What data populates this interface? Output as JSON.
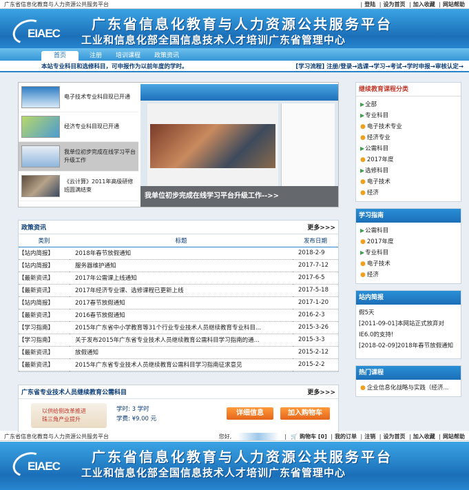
{
  "site_name": "广东省信息化教育与人力资源公共服务平台",
  "top_links": [
    "登陆",
    "设为首页",
    "加入收藏",
    "网站帮助"
  ],
  "banner": {
    "logo_text": "EIAEC",
    "title_line1": "广东省信息化教育与人力资源公共服务平台",
    "title_line2": "工业和信息化部全国信息技术人才培训广东省管理中心"
  },
  "nav": {
    "tabs": [
      "首页",
      "注册",
      "培训课程",
      "政策资讯"
    ]
  },
  "notice": {
    "text": "本站专业科目和选修科目，可申报作为以前年度的学时。",
    "flow": "[学习流程] 注册/登录→选课→学习→考试→学时申报→审核认定→"
  },
  "slider": {
    "thumbs": [
      "电子技术专业科目现已开通",
      "经济专业科目现已开通",
      "我单位初步完成在线学习平台升级工作",
      "《云计算》2011年高级研修班圆满结束"
    ],
    "caption": "我单位初步完成在线学习平台升级工作-->>"
  },
  "policy": {
    "title": "政策资讯",
    "more": "更多>>>",
    "headers": [
      "类别",
      "标题",
      "发布日期"
    ],
    "rows": [
      [
        "【站内简报】",
        "2018年春节放假通知",
        "2018-2-9"
      ],
      [
        "【站内简报】",
        "服务器维护通知",
        "2017-7-12"
      ],
      [
        "【最新资讯】",
        "2017年公需课上线通知",
        "2017-6-5"
      ],
      [
        "【最新资讯】",
        "2017年经济专业课、选修课程已更新上线",
        "2017-5-18"
      ],
      [
        "【站内简报】",
        "2017春节放假通知",
        "2017-1-20"
      ],
      [
        "【最新资讯】",
        "2016春节放假通知",
        "2016-2-3"
      ],
      [
        "【学习指南】",
        "2015年广东省中小学教育等31个行业专业技术人员继续教育专业科目...",
        "2015-3-26"
      ],
      [
        "【学习指南】",
        "关于发布2015年广东省专业技术人员继续教育公需科目学习指南的通...",
        "2015-3-3"
      ],
      [
        "【最新资讯】",
        "放假通知",
        "2015-2-12"
      ],
      [
        "【最新资讯】",
        "2015年广东省专业技术人员继续教育公需科目学习指南征求意见",
        "2015-2-2"
      ]
    ]
  },
  "course": {
    "title": "广东省专业技术人员继续教育公需科目",
    "more": "更多>>>",
    "img_text_1": "以供给侧改革推进",
    "img_text_2": "珠三角产业提升",
    "hours": "学时: 3 学时",
    "fee": "学费: ¥9.00 元",
    "detail_btn": "详细信息",
    "cart_btn": "加入购物车"
  },
  "categories": {
    "title": "继续教育课程分类",
    "items": [
      "全部",
      "专业科目",
      "电子技术专业",
      "经济专业",
      "公需科目",
      "2017年度",
      "选修科目",
      "电子技术",
      "经济"
    ]
  },
  "guide": {
    "title": "学习指南",
    "items": [
      "公需科目",
      "2017年度",
      "专业科目",
      "电子技术",
      "经济"
    ]
  },
  "site_news": {
    "title": "站内简报",
    "lines": [
      "假5天",
      "[2011-09-01]本网站正式放弃对IE6.0的支持!",
      "[2018-02-09]2018年春节放假通知"
    ]
  },
  "hot": {
    "title": "热门课程",
    "items": [
      "企业信息化战略与实践（经济..."
    ]
  },
  "topbar2": {
    "greeting": "您好,",
    "links": [
      "购物车 [0]",
      "我的订单",
      "注销",
      "设为首页",
      "加入收藏",
      "网站帮助"
    ]
  }
}
